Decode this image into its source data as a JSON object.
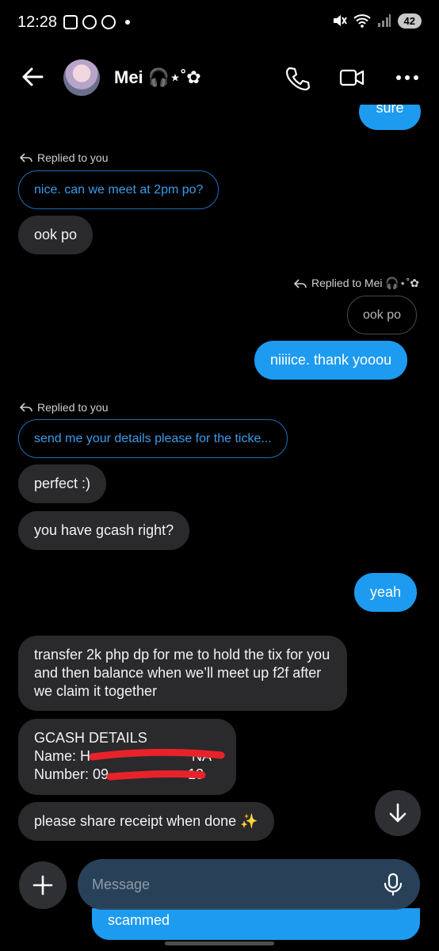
{
  "status_bar": {
    "time": "12:28",
    "battery": "42"
  },
  "header": {
    "contact_name": "Mei 🎧⋆˚✿"
  },
  "messages": {
    "top_partial": "sure",
    "reply1_label": "Replied to you",
    "reply1_quote": "nice. can we meet at 2pm po?",
    "m1": "ook po",
    "reply2_label": "Replied to Mei 🎧⋆˚✿",
    "reply2_quote": "ook po",
    "m2": "niiiice. thank yooou",
    "reply3_label": "Replied to you",
    "reply3_quote": "send me your details please for the ticke...",
    "m3": "perfect :)",
    "m4": "you have gcash right?",
    "m5": "yeah",
    "m6": "transfer 2k php  dp for me to hold the tix for you and then balance when we’ll meet up f2f after we claim it together",
    "m7_line1": "GCASH DETAILS",
    "m7_line2": "Name: H",
    "m7_line2_tail": "NA",
    "m7_line3": "Number: 09",
    "m7_line3_tail": "13",
    "m8": "please share receipt when done ✨",
    "behind_input": "scammed"
  },
  "composer": {
    "placeholder": "Message"
  },
  "colors": {
    "accent": "#1d9bf0",
    "incoming_bubble": "#2a2a2d",
    "redaction": "#e8222a"
  }
}
